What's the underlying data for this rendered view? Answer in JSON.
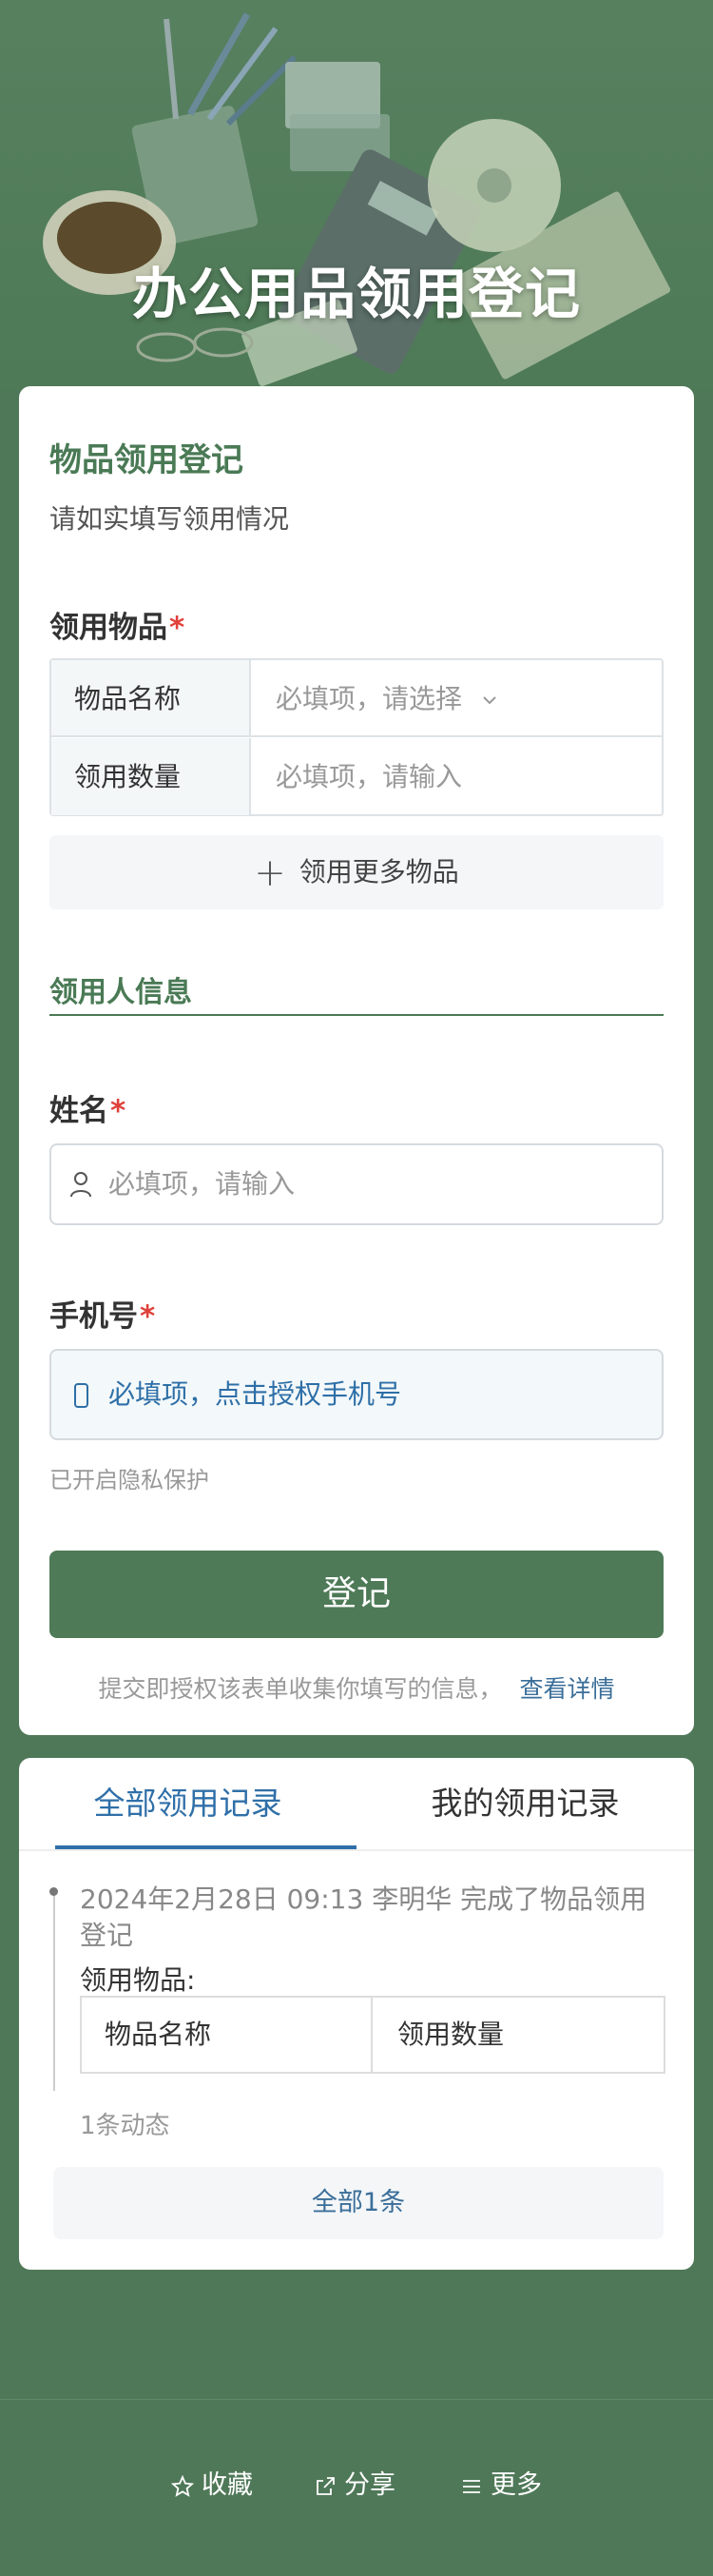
{
  "banner": {
    "title": "办公用品领用登记"
  },
  "form": {
    "title": "物品领用登记",
    "subtitle": "请如实填写领用情况",
    "items_label": "领用物品",
    "required_mark": "*",
    "item_name_label": "物品名称",
    "item_name_placeholder": "必填项，请选择",
    "quantity_label": "领用数量",
    "quantity_placeholder": "必填项，请输入",
    "add_more_label": "领用更多物品",
    "requester_section": "领用人信息",
    "name_label": "姓名",
    "name_placeholder": "必填项，请输入",
    "phone_label": "手机号",
    "phone_placeholder": "必填项，点击授权手机号",
    "privacy_note": "已开启隐私保护",
    "submit_label": "登记",
    "consent_text": "提交即授权该表单收集你填写的信息，",
    "consent_link": "查看详情"
  },
  "records": {
    "tabs": [
      {
        "label": "全部领用记录",
        "active": true
      },
      {
        "label": "我的领用记录",
        "active": false
      }
    ],
    "entry": {
      "text": "2024年2月28日 09:13  李明华 完成了物品领用登记",
      "items_label": "领用物品:",
      "col_name": "物品名称",
      "col_quantity": "领用数量"
    },
    "count_text": "1条动态",
    "all_button": "全部1条"
  },
  "footer": {
    "favorite": "收藏",
    "share": "分享",
    "more": "更多"
  },
  "colors": {
    "brand": "#4e7a57",
    "link": "#2f6fa8",
    "required": "#e0403a"
  }
}
